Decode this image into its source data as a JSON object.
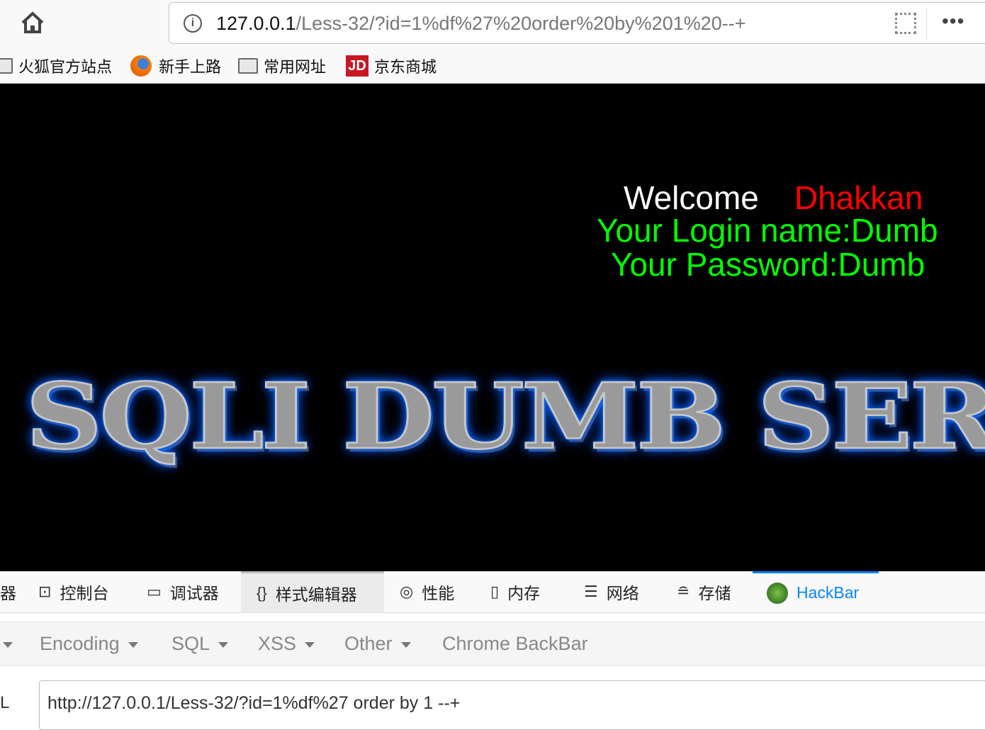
{
  "browser": {
    "url_host": "127.0.0.1",
    "url_path": "/Less-32/?id=1%df%27%20order%20by%201%20--+",
    "more_label": "•••",
    "bookmarks": [
      {
        "label": "火狐官方站点",
        "icon": "folder-icon"
      },
      {
        "label": "新手上路",
        "icon": "firefox-icon"
      },
      {
        "label": "常用网址",
        "icon": "folder-icon"
      },
      {
        "label": "京东商城",
        "icon": "jd-icon",
        "icon_text": "JD"
      }
    ]
  },
  "page": {
    "welcome": "Welcome",
    "user": "Dhakkan",
    "login": "Your Login name:Dumb",
    "password": "Your Password:Dumb",
    "banner": "SQLI DUMB SERIES",
    "colors": {
      "user": "#ff0000",
      "info": "#00ff00"
    }
  },
  "devtools": {
    "tabs": [
      {
        "label": "器"
      },
      {
        "label": "控制台",
        "icon": "console-icon"
      },
      {
        "label": "调试器",
        "icon": "debugger-icon"
      },
      {
        "label": "样式编辑器",
        "icon": "braces-icon",
        "selected": true
      },
      {
        "label": "性能",
        "icon": "performance-icon"
      },
      {
        "label": "内存",
        "icon": "memory-icon"
      },
      {
        "label": "网络",
        "icon": "network-icon"
      },
      {
        "label": "存储",
        "icon": "storage-icon"
      },
      {
        "label": "HackBar",
        "icon": "hackbar-icon",
        "active": true
      }
    ]
  },
  "hackbar": {
    "menus": [
      "Encoding",
      "SQL",
      "XSS",
      "Other"
    ],
    "link": "Chrome BackBar",
    "url_label": "L",
    "url_value": "http://127.0.0.1/Less-32/?id=1%df%27 order by 1 --+"
  }
}
